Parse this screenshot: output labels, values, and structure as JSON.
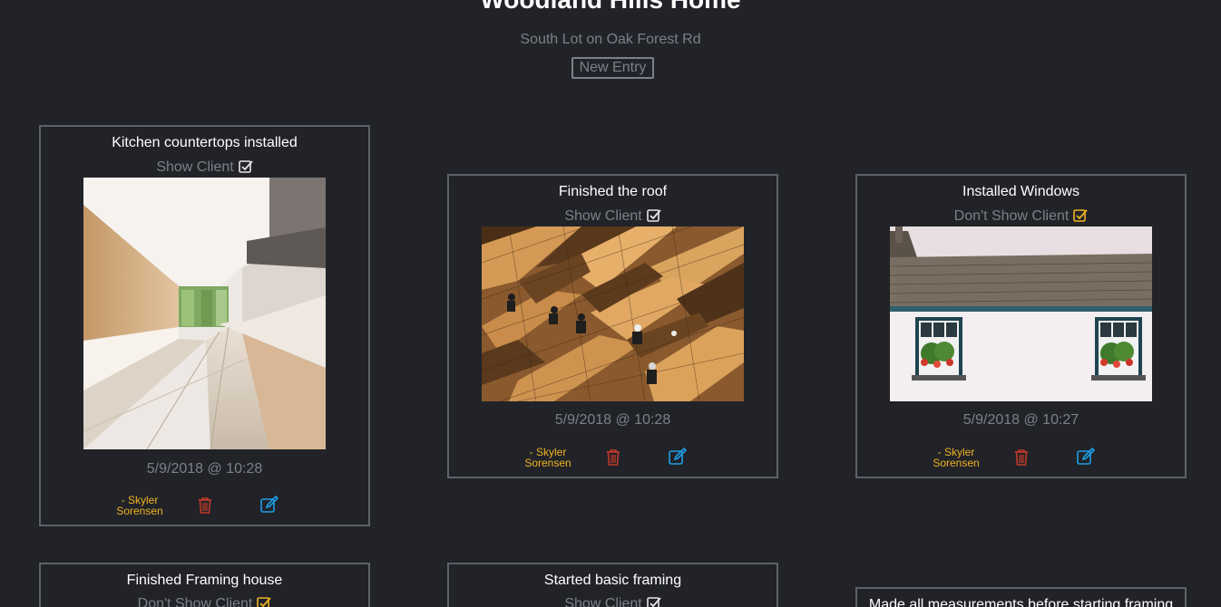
{
  "project": {
    "title": "Woodland Hills Home",
    "subtitle": "South Lot on Oak Forest Rd",
    "new_entry_label": "New Entry"
  },
  "colors": {
    "background": "#212328",
    "card_border": "#5e6167",
    "muted_text": "#7d8087",
    "author": "#f0b322",
    "delete": "#c0392b",
    "edit": "#1e9fe6",
    "checkbox_shown": "#e8e8e8",
    "checkbox_hidden": "#f0b322"
  },
  "entries": [
    {
      "title": "Kitchen countertops installed",
      "visibility": "Show Client",
      "visibility_icon": "checkbox-checked-icon",
      "photo": "kitchen-photo",
      "timestamp": "5/9/2018 @ 10:28",
      "author_line1": "- Skyler",
      "author_line2": "Sorensen"
    },
    {
      "title": "Finished the roof",
      "visibility": "Show Client",
      "visibility_icon": "checkbox-checked-icon",
      "photo": "roof-photo",
      "timestamp": "5/9/2018 @ 10:28",
      "author_line1": "- Skyler",
      "author_line2": "Sorensen"
    },
    {
      "title": "Installed Windows",
      "visibility": "Don't Show Client",
      "visibility_icon": "checkbox-checked-icon",
      "photo": "windows-photo",
      "timestamp": "5/9/2018 @ 10:27",
      "author_line1": "- Skyler",
      "author_line2": "Sorensen"
    },
    {
      "title": "Finished Framing house",
      "visibility": "Don't Show Client"
    },
    {
      "title": "Started basic framing",
      "visibility": "Show Client"
    },
    {
      "title": "Made all measurements before starting framing"
    }
  ]
}
